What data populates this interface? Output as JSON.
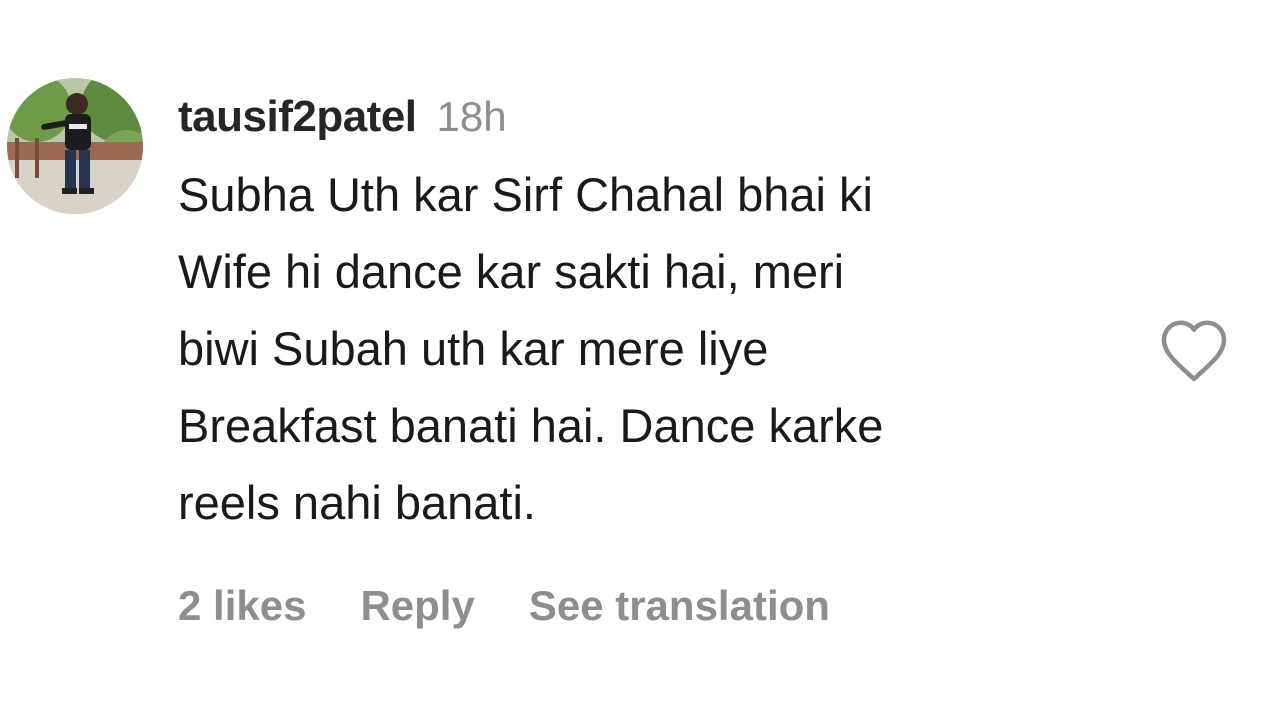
{
  "comment": {
    "username": "tausif2patel",
    "time": "18h",
    "text": "Subha Uth kar Sirf Chahal bhai ki\nWife hi dance kar sakti hai, meri\nbiwi Subah uth kar mere liye\nBreakfast banati hai. Dance karke\nreels nahi banati.",
    "likes": "2 likes",
    "reply_label": "Reply",
    "translate_label": "See translation",
    "like_icon": "heart-outline-icon",
    "avatar_icon": "user-avatar"
  },
  "colors": {
    "text": "#262626",
    "secondary": "#8e8e8e",
    "background": "#ffffff"
  }
}
